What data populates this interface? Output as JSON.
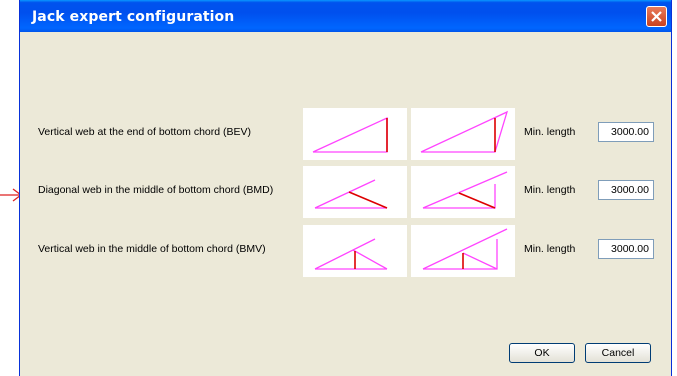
{
  "window": {
    "title": "Jack expert configuration",
    "close_icon": "close-x-icon"
  },
  "rows": [
    {
      "label": "Vertical web at the end of bottom chord (BEV)",
      "min_length_label": "Min. length",
      "min_length_value": "3000.00"
    },
    {
      "label": "Diagonal web in the middle of bottom chord (BMD)",
      "min_length_label": "Min. length",
      "min_length_value": "3000.00"
    },
    {
      "label": "Vertical web in the middle of bottom chord (BMV)",
      "min_length_label": "Min. length",
      "min_length_value": "3000.00"
    }
  ],
  "buttons": {
    "ok": "OK",
    "cancel": "Cancel"
  },
  "colors": {
    "chord": "#ff44ff",
    "web": "#dd0000",
    "titlebar": "#0053ee",
    "arrow": "#dd2222"
  }
}
